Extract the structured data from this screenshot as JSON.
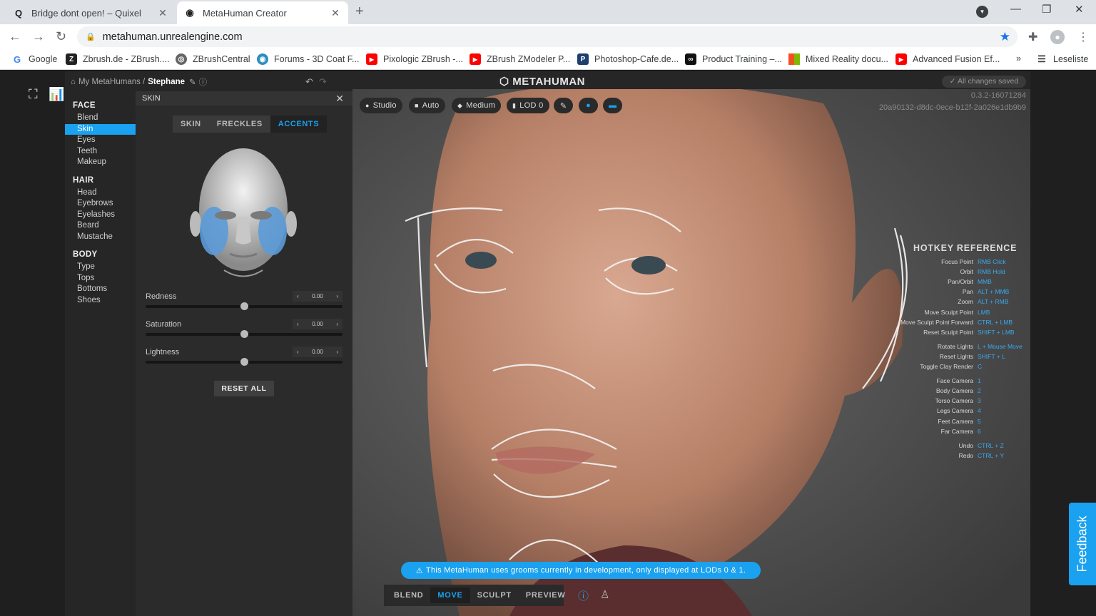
{
  "browser": {
    "tabs": [
      {
        "title": "Bridge dont open! – Quixel",
        "favicon": "quixel-icon"
      },
      {
        "title": "MetaHuman Creator",
        "favicon": "unreal-icon"
      }
    ],
    "url": "metahuman.unrealengine.com",
    "bookmarks": [
      {
        "label": "Google",
        "color": "#4285f4",
        "glyph": "G"
      },
      {
        "label": "Zbrush.de - ZBrush....",
        "color": "#222222",
        "glyph": "Z"
      },
      {
        "label": "ZBrushCentral",
        "color": "#555555",
        "glyph": "◎"
      },
      {
        "label": "Forums - 3D Coat F...",
        "color": "#2a8fbf",
        "glyph": "◉"
      },
      {
        "label": "Pixologic ZBrush -...",
        "color": "#ff0000",
        "glyph": "▶"
      },
      {
        "label": "ZBrush ZModeler P...",
        "color": "#ff0000",
        "glyph": "▶"
      },
      {
        "label": "Photoshop-Cafe.de...",
        "color": "#1c3f6e",
        "glyph": "P"
      },
      {
        "label": "Product Training –...",
        "color": "#111111",
        "glyph": "∞"
      },
      {
        "label": "Mixed Reality docu...",
        "color": "#f25022",
        "glyph": "■"
      },
      {
        "label": "Advanced Fusion Ef...",
        "color": "#ff0000",
        "glyph": "▶"
      }
    ],
    "more": "»",
    "reading_list": "Leseliste"
  },
  "app": {
    "breadcrumb": {
      "root": "My MetaHumans /",
      "current": "Stephane"
    },
    "logo": "METAHUMAN",
    "saved": "All changes saved",
    "version": "0.3.2-16071284",
    "guid": "20a90132-d8dc-0ece-b12f-2a026e1db9b9",
    "nav": {
      "face": {
        "title": "FACE",
        "items": [
          "Blend",
          "Skin",
          "Eyes",
          "Teeth",
          "Makeup"
        ]
      },
      "hair": {
        "title": "HAIR",
        "items": [
          "Head",
          "Eyebrows",
          "Eyelashes",
          "Beard",
          "Mustache"
        ]
      },
      "body": {
        "title": "BODY",
        "items": [
          "Type",
          "Tops",
          "Bottoms",
          "Shoes"
        ]
      }
    },
    "panel": {
      "title": "SKIN",
      "tabs": [
        "SKIN",
        "FRECKLES",
        "ACCENTS"
      ],
      "sliders": [
        {
          "label": "Redness",
          "value": "0.00"
        },
        {
          "label": "Saturation",
          "value": "0.00"
        },
        {
          "label": "Lightness",
          "value": "0.00"
        }
      ],
      "reset": "RESET ALL"
    },
    "viewport_buttons": [
      "Studio",
      "Auto",
      "Medium",
      "LOD 0"
    ],
    "hotkeys": {
      "title": "HOTKEY REFERENCE",
      "rows": [
        {
          "name": "Focus Point",
          "key": "RMB Click"
        },
        {
          "name": "Orbit",
          "key": "RMB Hold"
        },
        {
          "name": "Pan/Orbit",
          "key": "MMB"
        },
        {
          "name": "Pan",
          "key": "ALT + MMB"
        },
        {
          "name": "Zoom",
          "key": "ALT + RMB"
        },
        {
          "name": "Move Sculpt Point",
          "key": "LMB"
        },
        {
          "name": "Move Sculpt Point Forward",
          "key": "CTRL + LMB"
        },
        {
          "name": "Reset Sculpt Point",
          "key": "SHIFT + LMB"
        },
        {
          "name": "Rotate Lights",
          "key": "L + Mouse Move"
        },
        {
          "name": "Reset Lights",
          "key": "SHIFT + L"
        },
        {
          "name": "Toggle Clay Render",
          "key": "C"
        },
        {
          "name": "Face Camera",
          "key": "1"
        },
        {
          "name": "Body Camera",
          "key": "2"
        },
        {
          "name": "Torso Camera",
          "key": "3"
        },
        {
          "name": "Legs Camera",
          "key": "4"
        },
        {
          "name": "Feet Camera",
          "key": "5"
        },
        {
          "name": "Far Camera",
          "key": "6"
        },
        {
          "name": "Undo",
          "key": "CTRL + Z"
        },
        {
          "name": "Redo",
          "key": "CTRL + Y"
        }
      ]
    },
    "banner": "This MetaHuman uses grooms currently in development, only displayed at LODs 0 & 1.",
    "modes": [
      "BLEND",
      "MOVE",
      "SCULPT",
      "PREVIEW"
    ],
    "feedback": "Feedback"
  }
}
